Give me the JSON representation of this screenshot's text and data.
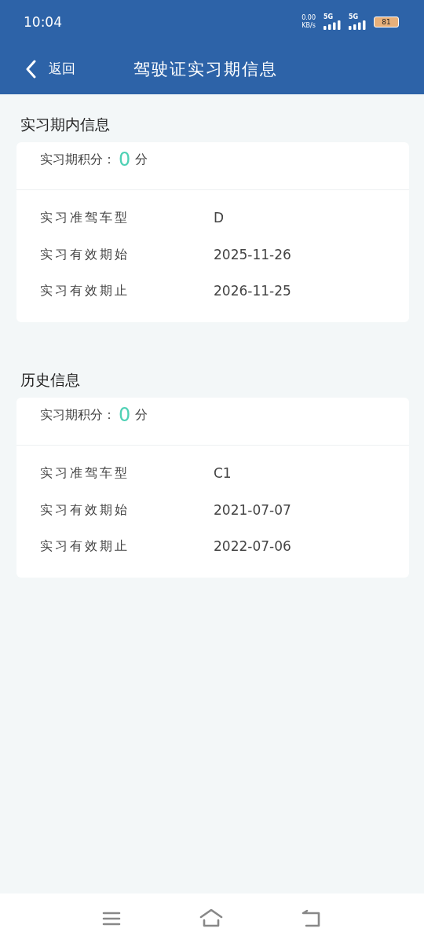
{
  "status_bar": {
    "time": "10:04",
    "speed": "0.00",
    "speed_unit": "KB/s",
    "networks": [
      "5G",
      "5G"
    ],
    "battery": "81"
  },
  "nav": {
    "back": "返回",
    "title": "驾驶证实习期信息"
  },
  "sections": [
    {
      "title": "实习期内信息",
      "score_label": "实习期积分：",
      "score": "0",
      "score_unit": "分",
      "rows": [
        {
          "label": "实习准驾车型",
          "value": "D"
        },
        {
          "label": "实习有效期始",
          "value": "2025-11-26"
        },
        {
          "label": "实习有效期止",
          "value": "2026-11-25"
        }
      ]
    },
    {
      "title": "历史信息",
      "score_label": "实习期积分：",
      "score": "0",
      "score_unit": "分",
      "rows": [
        {
          "label": "实习准驾车型",
          "value": "C1"
        },
        {
          "label": "实习有效期始",
          "value": "2021-07-07"
        },
        {
          "label": "实习有效期止",
          "value": "2022-07-06"
        }
      ]
    }
  ]
}
